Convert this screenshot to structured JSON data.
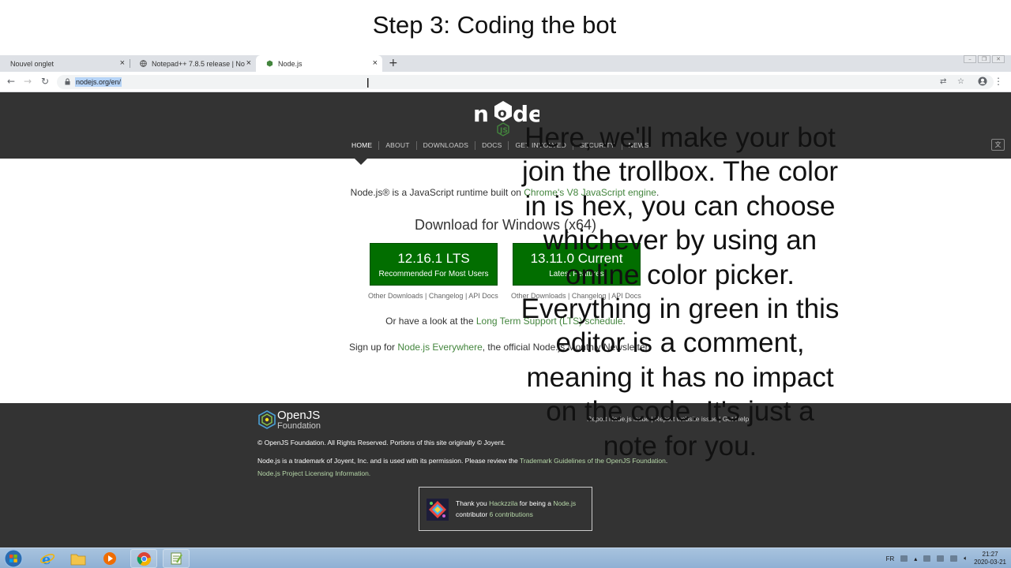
{
  "slide": {
    "title": "Step 3: Coding the bot"
  },
  "browser": {
    "tabs": [
      {
        "label": "Nouvel onglet",
        "close": "×"
      },
      {
        "label": "Notepad++ 7.8.5 release | Notep",
        "close": "×"
      },
      {
        "label": "Node.js",
        "close": "×"
      }
    ],
    "new_tab": "+",
    "url": "nodejs.org/en/"
  },
  "site": {
    "nav": [
      "HOME",
      "ABOUT",
      "DOWNLOADS",
      "DOCS",
      "GET INVOLVED",
      "SECURITY",
      "NEWS"
    ],
    "intro_prefix": "Node.js® is a JavaScript runtime built on ",
    "intro_link": "Chrome's V8 JavaScript engine",
    "intro_suffix": ".",
    "download_title": "Download for Windows (x64)",
    "lts": {
      "version": "12.16.1 LTS",
      "sub": "Recommended For Most Users"
    },
    "current": {
      "version": "13.11.0 Current",
      "sub": "Latest Features"
    },
    "lts_links": [
      "Other Downloads",
      "Changelog",
      "API Docs"
    ],
    "current_links": [
      "Other Downloads",
      "Changelog",
      "API Docs"
    ],
    "lts_line_prefix": "Or have a look at the ",
    "lts_line_link": "Long Term Support (LTS) schedule",
    "lts_line_suffix": ".",
    "signup_prefix": "Sign up for ",
    "signup_link": "Node.js Everywhere",
    "signup_suffix": ", the official Node.js Monthly Newsletter."
  },
  "footer": {
    "org_name": "OpenJS",
    "org_sub": "Foundation",
    "links": [
      "Report Node.js issue",
      "Report website issue",
      "Get Help"
    ],
    "copyright": "© OpenJS Foundation. All Rights Reserved. Portions of this site originally © Joyent.",
    "trademark_prefix": "Node.js is a trademark of Joyent, Inc. and is used with its permission. Please review the ",
    "trademark_link": "Trademark Guidelines of the OpenJS Foundation",
    "trademark_suffix": ".",
    "licensing": "Node.js Project Licensing Information.",
    "contrib": {
      "prefix": "Thank you ",
      "user": "Hackzzila",
      "mid": " for being a ",
      "project": "Node.js",
      "line2_prefix": "contributor ",
      "count": "6 contributions"
    }
  },
  "overlay": {
    "lines": [
      "Here, we'll make your bot",
      "join the trollbox. The color",
      "in is hex, you can choose",
      "whichever by using an",
      "online color picker.",
      "Everything in green in this",
      "editor is a comment,",
      "meaning it has no impact",
      "on the code. It's just a",
      "note for you."
    ]
  },
  "taskbar": {
    "lang": "FR",
    "time": "21:27",
    "date": "2020-03-21"
  },
  "colors": {
    "node_green": "#43853d",
    "download_button": "#026e00",
    "header_bg": "#333333"
  }
}
